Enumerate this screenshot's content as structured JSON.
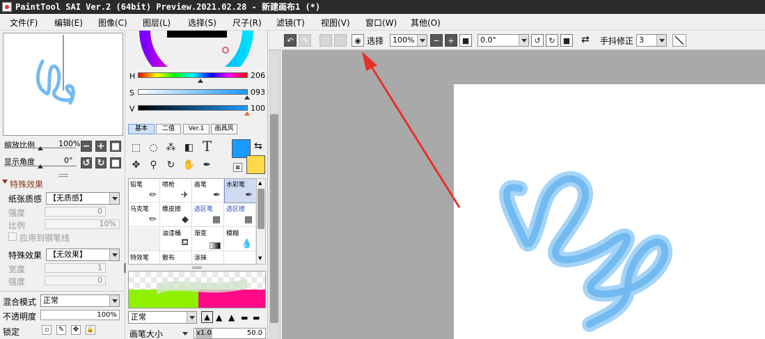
{
  "window": {
    "title": "PaintTool SAI Ver.2 (64bit) Preview.2021.02.28 - 新建画布1 (*)"
  },
  "menu": [
    "文件(F)",
    "编辑(E)",
    "图像(C)",
    "图层(L)",
    "选择(S)",
    "尺子(R)",
    "滤镜(T)",
    "视图(V)",
    "窗口(W)",
    "其他(O)"
  ],
  "navigator": {
    "zoom_label": "缩放比例",
    "zoom_value": "100%",
    "angle_label": "显示角度",
    "angle_value": "0°"
  },
  "effects": {
    "section_title": "特殊效果",
    "paper_label": "纸张质感",
    "paper_value": "【无质感】",
    "strength_label": "强度",
    "strength_value": "0",
    "scale_label": "比例",
    "scale_value": "10%",
    "apply_label": "应用到钢笔线",
    "effect_label": "特殊效果",
    "effect_value": "【无效果】",
    "width_label": "宽度",
    "width_value": "1",
    "strength2_label": "强度",
    "strength2_value": "0"
  },
  "layer": {
    "blend_label": "混合模式",
    "blend_value": "正常",
    "opacity_label": "不透明度",
    "opacity_value": "100%",
    "lock_label": "锁定"
  },
  "color": {
    "h_label": "H",
    "h_value": "206",
    "s_label": "S",
    "s_value": "093",
    "v_label": "V",
    "v_value": "100",
    "primary": "#1a9bff",
    "secondary": "#ffd94a"
  },
  "tool_tabs": [
    "基本",
    "二值",
    "Ver.1",
    "画具风"
  ],
  "tools": [
    "rect-select-icon",
    "lasso-icon",
    "magic-wand-icon",
    "shape-icon",
    "text-icon",
    "move-icon",
    "zoom-icon",
    "rotate-icon",
    "hand-icon",
    "eyedropper-icon"
  ],
  "brushes": [
    {
      "label": "铅笔"
    },
    {
      "label": "喷枪"
    },
    {
      "label": "画笔"
    },
    {
      "label": "水彩笔"
    },
    {
      "label": "马克笔"
    },
    {
      "label": "橡皮擦"
    },
    {
      "label": "选区笔"
    },
    {
      "label": "选区擦"
    },
    {
      "label": ""
    },
    {
      "label": "油漆桶"
    },
    {
      "label": "渐变"
    },
    {
      "label": "模糊"
    },
    {
      "label": "特效笔"
    },
    {
      "label": "散布"
    },
    {
      "label": "涂抹"
    },
    {
      "label": ""
    }
  ],
  "brush_settings": {
    "mode_value": "正常",
    "size_label": "画笔大小",
    "size_mult": "x1.0",
    "size_value": "50.0"
  },
  "canvas_toolbar": {
    "select_label": "选择",
    "zoom_value": "100%",
    "angle_value": "0.0°",
    "stabilizer_label": "手抖修正",
    "stabilizer_value": "3"
  }
}
